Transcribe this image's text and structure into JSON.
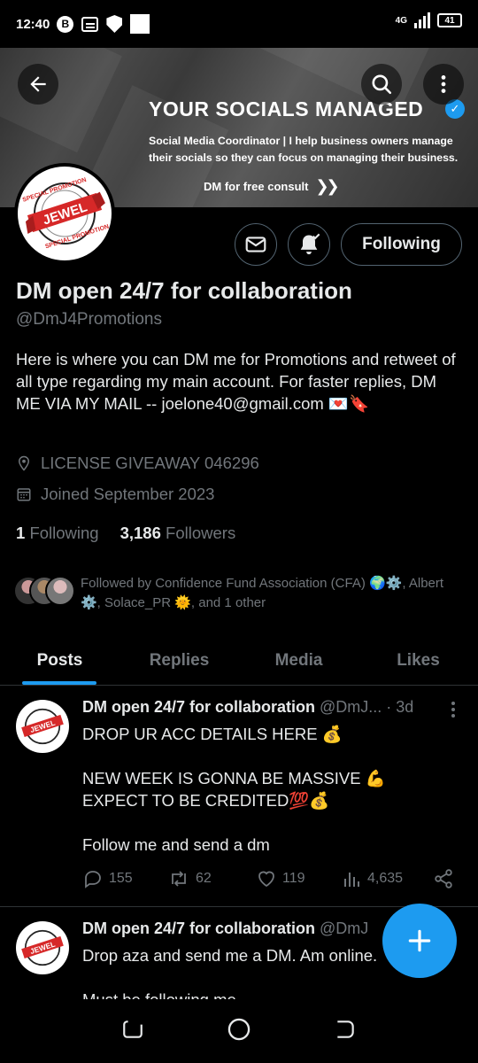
{
  "status_bar": {
    "time": "12:40",
    "b_badge": "B",
    "network": "4G",
    "battery": "41"
  },
  "banner": {
    "title": "YOUR SOCIALS MANAGED",
    "subtitle": "Social Media Coordinator | I help business owners manage their socials so they can focus on managing their business.",
    "cta": "DM for free consult"
  },
  "avatar_logo": {
    "top_text": "SPECIAL PROMOTION",
    "main_text": "JEWEL",
    "bottom_text": "SPECIAL PROMOTION"
  },
  "profile": {
    "following_button": "Following",
    "display_name": "DM open 24/7 for collaboration",
    "handle": "@DmJ4Promotions",
    "bio": "Here is where you can DM me for Promotions and retweet of all type regarding my main account.  For faster replies, DM ME VIA MY MAIL -- joelone40@gmail.com 💌🔖",
    "location": "LICENSE GIVEAWAY 046296",
    "joined": "Joined September 2023",
    "following_count": "1",
    "following_label": "Following",
    "followers_count": "3,186",
    "followers_label": "Followers",
    "followed_by": "Followed by Confidence Fund Association (CFA) 🌍⚙️, Albert ⚙️, Solace_PR 🌞, and 1 other"
  },
  "tabs": [
    {
      "label": "Posts"
    },
    {
      "label": "Replies"
    },
    {
      "label": "Media"
    },
    {
      "label": "Likes"
    }
  ],
  "posts": [
    {
      "name": "DM open 24/7 for collaboration",
      "meta": "@DmJ... · 3d",
      "body": "DROP UR ACC DETAILS HERE 💰\n\nNEW WEEK IS GONNA BE MASSIVE 💪\n  EXPECT TO BE CREDITED💯💰\n\nFollow me and send a dm",
      "replies": "155",
      "reposts": "62",
      "likes": "119",
      "views": "4,635"
    },
    {
      "name": "DM open 24/7 for collaboration",
      "meta": "@DmJ",
      "body": "Drop aza and send me a DM. Am online.\n\nMust be following me"
    }
  ],
  "colors": {
    "accent": "#1d9bf0",
    "muted": "#71767b",
    "text": "#e7e9ea",
    "divider": "#2f3336",
    "logo_red": "#d62828"
  }
}
